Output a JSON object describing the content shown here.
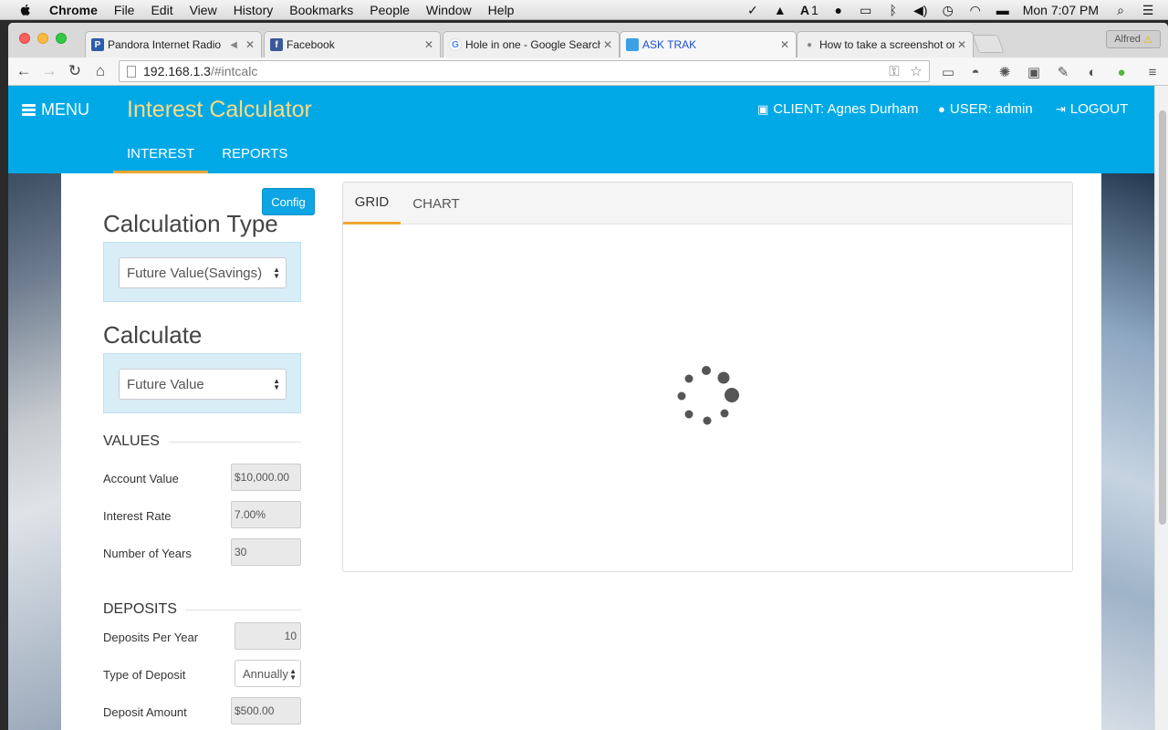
{
  "os_menubar": {
    "app_name": "Chrome",
    "menus": [
      "File",
      "Edit",
      "View",
      "History",
      "Bookmarks",
      "People",
      "Window",
      "Help"
    ],
    "adobe_count": "1",
    "clock": "Mon 7:07 PM"
  },
  "browser": {
    "tabs": [
      {
        "title": "Pandora Internet Radio",
        "icon": "pandora-icon",
        "icon_text": "P",
        "icon_color": "#2c5dab"
      },
      {
        "title": "Facebook",
        "icon": "facebook-icon",
        "icon_text": "f",
        "icon_color": "#3b5998"
      },
      {
        "title": "Hole in one - Google Search",
        "icon": "google-icon",
        "icon_text": "G",
        "icon_color": "#4285f4"
      },
      {
        "title": "ASK TRAK",
        "icon": "asktrak-icon",
        "icon_text": "",
        "icon_color": "#3ca0e6"
      },
      {
        "title": "How to take a screenshot on Mac",
        "icon": "apple-icon",
        "icon_text": "",
        "icon_color": "#888888"
      }
    ],
    "profile_name": "Alfred",
    "url_host": "192.168.1.3",
    "url_path": "/#intcalc"
  },
  "app": {
    "menu_label": "MENU",
    "title": "Interest Calculator",
    "client_label": "CLIENT: Agnes Durham",
    "user_label": "USER: admin",
    "logout_label": "LOGOUT",
    "nav_tabs": [
      "INTEREST",
      "REPORTS"
    ],
    "accent_color": "#00a9e6",
    "title_color": "#ffd982"
  },
  "form": {
    "config_label": "Config",
    "calc_type_heading": "Calculation Type",
    "calc_type_value": "Future Value(Savings)",
    "calculate_heading": "Calculate",
    "calculate_value": "Future Value",
    "values_heading": "VALUES",
    "account_value_label": "Account Value",
    "account_value": "$10,000.00",
    "interest_rate_label": "Interest Rate",
    "interest_rate": "7.00%",
    "years_label": "Number of Years",
    "years": "30",
    "deposits_heading": "DEPOSITS",
    "deposits_per_year_label": "Deposits Per Year",
    "deposits_per_year": "10",
    "deposit_type_label": "Type of Deposit",
    "deposit_type": "Annually",
    "deposit_amount_label": "Deposit Amount",
    "deposit_amount": "$500.00"
  },
  "results": {
    "tabs": [
      "GRID",
      "CHART"
    ],
    "active_tab": "GRID",
    "state": "loading"
  }
}
